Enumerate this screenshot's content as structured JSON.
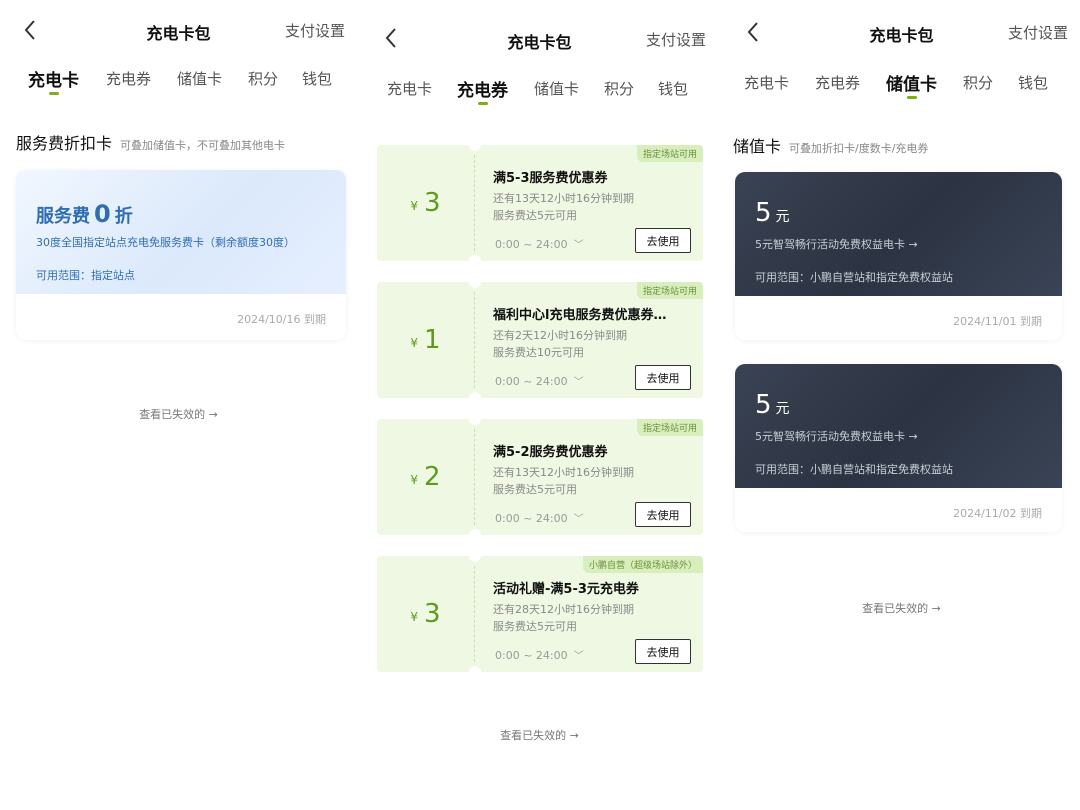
{
  "common": {
    "title": "充电卡包",
    "pay_settings": "支付设置",
    "tabs": [
      "充电卡",
      "充电券",
      "储值卡",
      "积分",
      "钱包"
    ],
    "view_invalid": "查看已失效的 →"
  },
  "panel1": {
    "section_title": "服务费折扣卡",
    "section_sub": "可叠加储值卡，不可叠加其他电卡",
    "card": {
      "name_prefix": "服务费",
      "discount": "0",
      "name_suffix": "折",
      "desc": "30度全国指定站点充电免服务费卡（剩余额度30度）",
      "scope": "可用范围：指定站点",
      "expiry": "2024/10/16  到期"
    }
  },
  "panel2": {
    "coupons": [
      {
        "currency": "¥",
        "amount": "3",
        "tag": "指定场站可用",
        "title": "满5-3服务费优惠券",
        "remaining": "还有13天12小时16分钟到期",
        "condition": "服务费达5元可用",
        "time": "0:00 ~ 24:00",
        "button": "去使用"
      },
      {
        "currency": "¥",
        "amount": "1",
        "tag": "指定场站可用",
        "title": "福利中心l充电服务费优惠券…",
        "remaining": "还有2天12小时16分钟到期",
        "condition": "服务费达10元可用",
        "time": "0:00 ~ 24:00",
        "button": "去使用"
      },
      {
        "currency": "¥",
        "amount": "2",
        "tag": "指定场站可用",
        "title": "满5-2服务费优惠券",
        "remaining": "还有13天12小时16分钟到期",
        "condition": "服务费达5元可用",
        "time": "0:00 ~ 24:00",
        "button": "去使用"
      },
      {
        "currency": "¥",
        "amount": "3",
        "tag": "小鹏自营（超级场站除外）",
        "title": "活动礼赠-满5-3元充电券",
        "remaining": "还有28天12小时16分钟到期",
        "condition": "服务费达5元可用",
        "time": "0:00 ~ 24:00",
        "button": "去使用"
      }
    ]
  },
  "panel3": {
    "section_title": "储值卡",
    "section_sub": "可叠加折扣卡/度数卡/充电券",
    "cards": [
      {
        "amount": "5",
        "unit": "元",
        "desc": "5元智驾畅行活动免费权益电卡 →",
        "scope": "可用范围：小鹏自营站和指定免费权益站",
        "expiry": "2024/11/01  到期"
      },
      {
        "amount": "5",
        "unit": "元",
        "desc": "5元智驾畅行活动免费权益电卡 →",
        "scope": "可用范围：小鹏自营站和指定免费权益站",
        "expiry": "2024/11/02  到期"
      }
    ]
  }
}
